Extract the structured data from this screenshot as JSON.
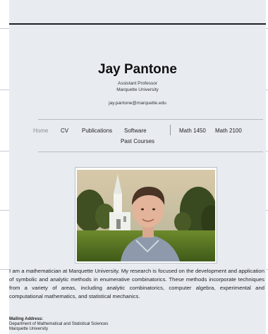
{
  "header": {
    "name": "Jay Pantone",
    "title": "Assistant Professor",
    "affiliation": "Marquette University",
    "email": "jay.pantone@marquette.edu"
  },
  "nav": {
    "items": [
      {
        "label": "Home",
        "active": true
      },
      {
        "label": "CV",
        "active": false
      },
      {
        "label": "Publications",
        "active": false
      },
      {
        "label": "Software",
        "active": false
      },
      {
        "label": "Math 1450",
        "active": false
      },
      {
        "label": "Math 2100",
        "active": false
      },
      {
        "label": "Past Courses",
        "active": false
      }
    ]
  },
  "photo": {
    "icon": "profile-photo"
  },
  "bio": "I am a mathematician at Marquette University. My research is focused on the development and application of symbolic and analytic methods in enumerative combinatorics. These methods incorporate techniques from a variety of areas, including analytic combinatorics, computer algebra, experimental and computational mathematics, and statistical mechanics.",
  "mailing": {
    "title": "Mailing Address:",
    "lines": [
      "Department of Mathematical and Statistical Sciences",
      "Marquette University"
    ]
  },
  "colors": {
    "background": "#e8ecf1",
    "topbar": "#1f1f1f",
    "nav_active": "#8a8f96"
  }
}
